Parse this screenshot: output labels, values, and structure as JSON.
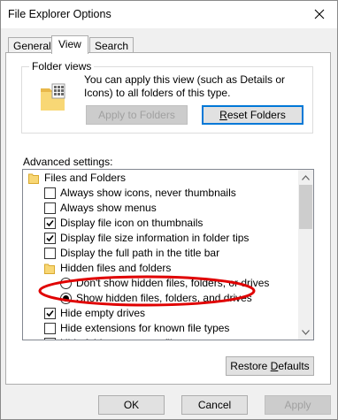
{
  "window": {
    "title": "File Explorer Options"
  },
  "tabs": [
    {
      "label": "General",
      "active": false
    },
    {
      "label": "View",
      "active": true
    },
    {
      "label": "Search",
      "active": false
    }
  ],
  "folder_views": {
    "legend": "Folder views",
    "description": "You can apply this view (such as Details or Icons) to all folders of this type.",
    "apply_button": "Apply to Folders",
    "reset_button_prefix": "",
    "reset_button_accel": "R",
    "reset_button_rest": "eset Folders"
  },
  "advanced": {
    "label": "Advanced settings:",
    "items": [
      {
        "kind": "folder",
        "label": "Files and Folders",
        "indent": 0
      },
      {
        "kind": "checkbox",
        "label": "Always show icons, never thumbnails",
        "checked": false,
        "indent": 1
      },
      {
        "kind": "checkbox",
        "label": "Always show menus",
        "checked": false,
        "indent": 1
      },
      {
        "kind": "checkbox",
        "label": "Display file icon on thumbnails",
        "checked": true,
        "indent": 1
      },
      {
        "kind": "checkbox",
        "label": "Display file size information in folder tips",
        "checked": true,
        "indent": 1
      },
      {
        "kind": "checkbox",
        "label": "Display the full path in the title bar",
        "checked": false,
        "indent": 1
      },
      {
        "kind": "folder",
        "label": "Hidden files and folders",
        "indent": 1
      },
      {
        "kind": "radio",
        "label": "Don't show hidden files, folders, or drives",
        "checked": false,
        "indent": 2
      },
      {
        "kind": "radio",
        "label": "Show hidden files, folders, and drives",
        "checked": true,
        "indent": 2
      },
      {
        "kind": "checkbox",
        "label": "Hide empty drives",
        "checked": true,
        "indent": 1
      },
      {
        "kind": "checkbox",
        "label": "Hide extensions for known file types",
        "checked": false,
        "indent": 1
      },
      {
        "kind": "checkbox",
        "label": "Hide folder merge conflicts",
        "checked": true,
        "indent": 1
      }
    ]
  },
  "restore_defaults": {
    "prefix": "Restore ",
    "accel": "D",
    "rest": "efaults"
  },
  "footer": {
    "ok": "OK",
    "cancel": "Cancel",
    "apply": "Apply"
  },
  "colors": {
    "highlight_ellipse": "#e00000",
    "default_button_border": "#0078d7",
    "folder_yellow": "#f8d775"
  }
}
